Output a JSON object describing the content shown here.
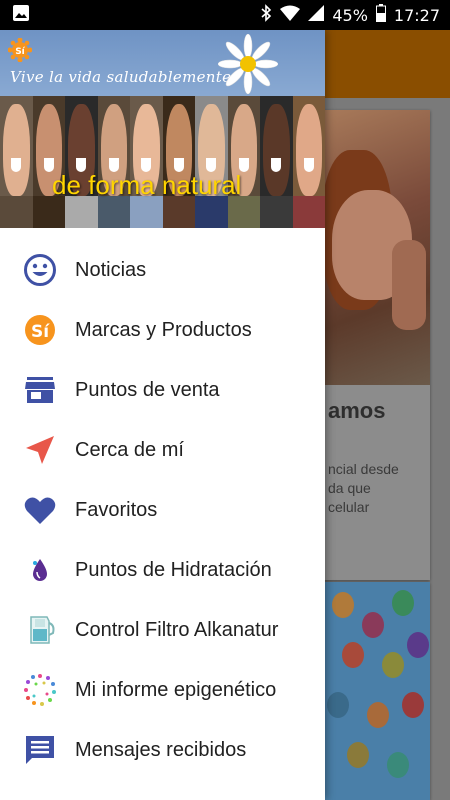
{
  "status_bar": {
    "battery_percent": "45%",
    "time": "17:27"
  },
  "drawer": {
    "header": {
      "logo_text": "Sí",
      "slogan": "Vive la vida saludablemente",
      "tagline": "de forma natural"
    },
    "menu_items": [
      {
        "label": "Noticias",
        "icon": "smiley-icon"
      },
      {
        "label": "Marcas y Productos",
        "icon": "brand-logo-icon"
      },
      {
        "label": "Puntos de venta",
        "icon": "store-icon"
      },
      {
        "label": "Cerca de mí",
        "icon": "navigation-arrow-icon"
      },
      {
        "label": "Favoritos",
        "icon": "heart-icon"
      },
      {
        "label": "Puntos de Hidratación",
        "icon": "water-drop-icon"
      },
      {
        "label": "Control Filtro Alkanatur",
        "icon": "water-filter-jug-icon"
      },
      {
        "label": "Mi informe epigenético",
        "icon": "epigenetica-logo-icon"
      },
      {
        "label": "Mensajes recibidos",
        "icon": "message-icon"
      }
    ]
  },
  "background": {
    "card_title": "amos",
    "card_text": "ncial desde\nda que\n celular"
  },
  "colors": {
    "accent": "#3f51a5",
    "brand_orange": "#f7941d",
    "toolbar": "#e68a00",
    "tagline": "#ffd500"
  }
}
